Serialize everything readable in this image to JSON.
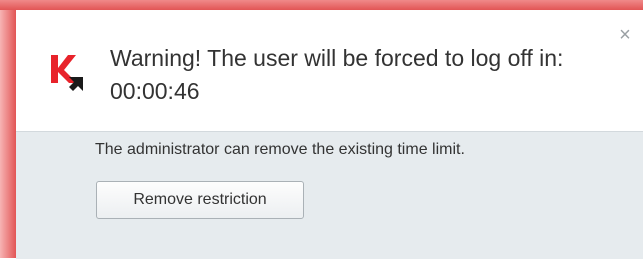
{
  "notification": {
    "title": "Warning! The user will be forced to log off in: 00:00:46",
    "description": "The administrator can remove the existing time limit.",
    "button_label": "Remove restriction",
    "close_glyph": "×",
    "logo_icon": "kaspersky-logo-icon",
    "accent_color": "#e25555",
    "logo_color": "#e8232b"
  }
}
